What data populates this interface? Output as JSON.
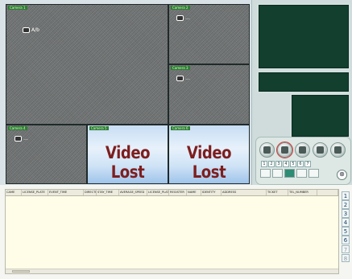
{
  "cameras": [
    {
      "label": "Camera 1",
      "tag": "A/b",
      "status": "live"
    },
    {
      "label": "Camera 2",
      "tag": "…",
      "status": "live"
    },
    {
      "label": "Camera 3",
      "tag": "…",
      "status": "live"
    },
    {
      "label": "Camera 4",
      "tag": "…",
      "status": "live"
    },
    {
      "label": "Camera 5",
      "overlay": "Video Lost",
      "status": "lost"
    },
    {
      "label": "Camera 6",
      "overlay": "Video Lost",
      "status": "lost"
    }
  ],
  "controls": {
    "icons": [
      "camera-icon",
      "record-icon",
      "playback-icon",
      "export-icon",
      "print-icon"
    ],
    "page_numbers": [
      "1",
      "2",
      "3",
      "4",
      "5",
      "6",
      "7"
    ],
    "layouts": [
      "single-layout-icon",
      "quad-layout-icon",
      "six-layout-icon",
      "nine-layout-icon",
      "sixteen-layout-icon"
    ],
    "close_glyph": "⊗"
  },
  "table": {
    "columns": [
      "CAME",
      "LICENSE_PLATE",
      "EVENT_TIME",
      "DIRECTI",
      "STAY_TIME",
      "AVERAGE_SPEED",
      "LICENSE_PLATE",
      "REGISTER",
      "NAME",
      "IDENTITY",
      "ADDRESS",
      "TICKET",
      "TEL_NUMBER"
    ]
  },
  "tabs": [
    "1",
    "2",
    "3",
    "4",
    "5",
    "6",
    "7",
    "8"
  ],
  "colors": {
    "accent": "#2d8c74",
    "lost_text": "#7d1e1e",
    "preview": "#123f2e"
  }
}
